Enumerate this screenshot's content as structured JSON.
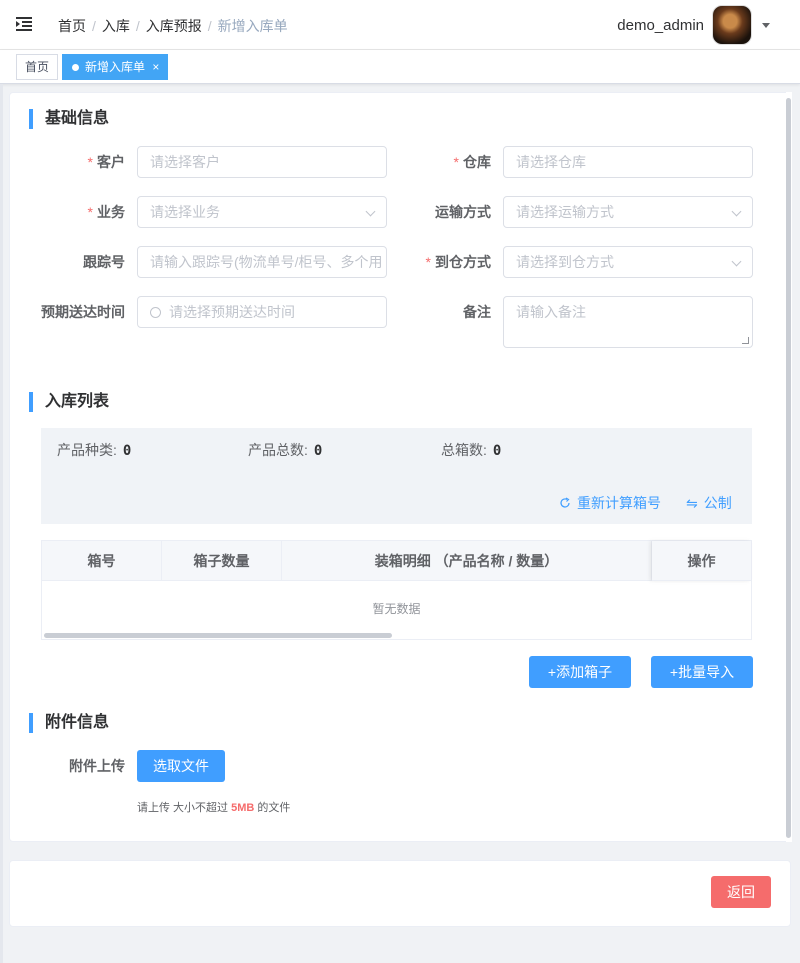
{
  "header": {
    "breadcrumbs": [
      "首页",
      "入库",
      "入库预报",
      "新增入库单"
    ],
    "separator": "/",
    "username": "demo_admin"
  },
  "tags": {
    "home": "首页",
    "active": "新增入库单",
    "close": "×"
  },
  "basic": {
    "title": "基础信息",
    "required_mark": "*",
    "customer": {
      "label": "客户",
      "placeholder": "请选择客户"
    },
    "warehouse": {
      "label": "仓库",
      "placeholder": "请选择仓库"
    },
    "business": {
      "label": "业务",
      "placeholder": "请选择业务"
    },
    "shipping": {
      "label": "运输方式",
      "placeholder": "请选择运输方式"
    },
    "tracking": {
      "label": "跟踪号",
      "placeholder": "请输入跟踪号(物流单号/柜号、多个用"
    },
    "arrival": {
      "label": "到仓方式",
      "placeholder": "请选择到仓方式"
    },
    "eta": {
      "label": "预期送达时间",
      "placeholder": "请选择预期送达时间"
    },
    "remark": {
      "label": "备注",
      "placeholder": "请输入备注"
    }
  },
  "inbound": {
    "title": "入库列表",
    "product_types_label": "产品种类:",
    "product_types_value": "0",
    "product_total_label": "产品总数:",
    "product_total_value": "0",
    "box_total_label": "总箱数:",
    "box_total_value": "0",
    "recalc": "重新计算箱号",
    "metric": "公制",
    "columns": [
      "箱号",
      "箱子数量",
      "装箱明细 （产品名称 / 数量）",
      "操作"
    ],
    "empty_text": "暂无数据",
    "add_box": "+添加箱子",
    "batch_import": "+批量导入"
  },
  "attachment": {
    "title": "附件信息",
    "upload_label": "附件上传",
    "choose_file": "选取文件",
    "hint_prefix": "请上传 大小不超过",
    "hint_size": "5MB",
    "hint_suffix": "的文件"
  },
  "footer": {
    "back": "返回"
  },
  "colors": {
    "primary": "#409eff",
    "danger": "#f56c6c",
    "tag_active": "#42a5f5"
  }
}
